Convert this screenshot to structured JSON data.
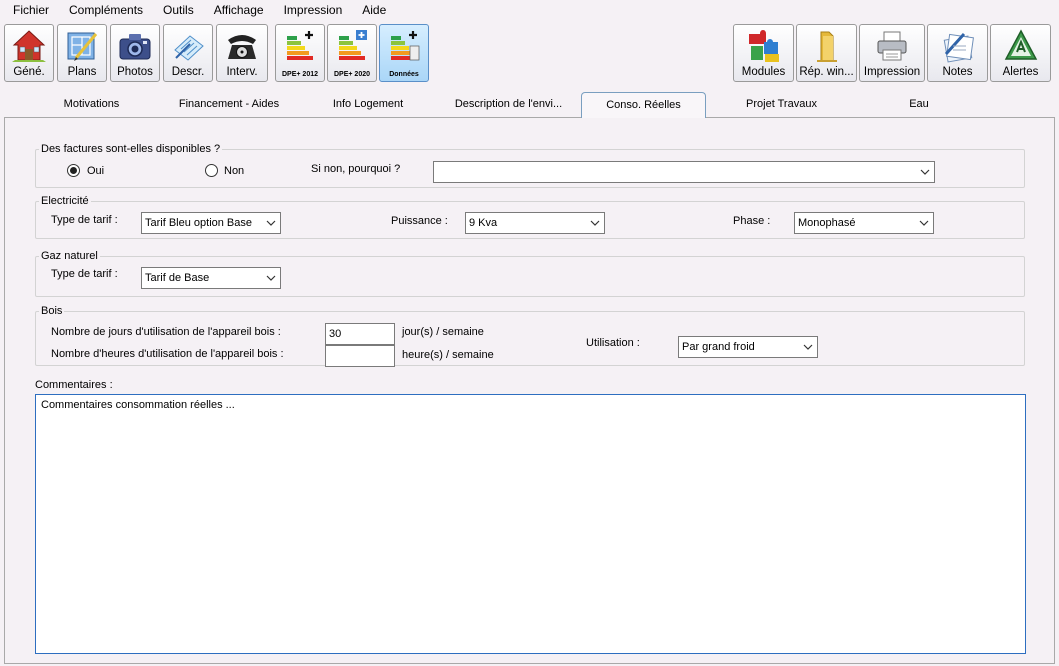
{
  "menu": [
    "Fichier",
    "Compléments",
    "Outils",
    "Affichage",
    "Impression",
    "Aide"
  ],
  "toolbar_left": [
    {
      "label": "Géné.",
      "icon": "house-icon"
    },
    {
      "label": "Plans",
      "icon": "plans-icon"
    },
    {
      "label": "Photos",
      "icon": "camera-icon"
    },
    {
      "label": "Descr.",
      "icon": "description-icon"
    },
    {
      "label": "Interv.",
      "icon": "telephone-icon"
    },
    {
      "label": "DPE+ 2012",
      "icon": "energy-label-icon"
    },
    {
      "label": "DPE+ 2020",
      "icon": "energy-label-icon"
    },
    {
      "label": "Données",
      "icon": "energy-label-icon"
    }
  ],
  "toolbar_right": [
    {
      "label": "Modules",
      "icon": "puzzle-icon"
    },
    {
      "label": "Rép. win...",
      "icon": "folder-icon"
    },
    {
      "label": "Impression",
      "icon": "printer-icon"
    },
    {
      "label": "Notes",
      "icon": "notes-icon"
    },
    {
      "label": "Alertes",
      "icon": "warning-icon"
    }
  ],
  "tabs": [
    "Motivations",
    "Financement  - Aides",
    "Info Logement",
    "Description de l'envi...",
    "Conso. Réelles",
    "Projet Travaux",
    "Eau"
  ],
  "active_tab": "Conso. Réelles",
  "factures": {
    "legend": "Des factures sont-elles disponibles ?",
    "oui": "Oui",
    "non": "Non",
    "selected": "Oui",
    "why_label": "Si non, pourquoi ?",
    "why_value": ""
  },
  "electricite": {
    "legend": "Electricité",
    "tarif_label": "Type de tarif :",
    "tarif_value": "Tarif Bleu option Base",
    "puissance_label": "Puissance :",
    "puissance_value": "9 Kva",
    "phase_label": "Phase :",
    "phase_value": "Monophasé"
  },
  "gaz": {
    "legend": "Gaz naturel",
    "tarif_label": "Type de tarif :",
    "tarif_value": "Tarif de Base"
  },
  "bois": {
    "legend": "Bois",
    "jours_label": "Nombre de jours d'utilisation de l'appareil bois :",
    "jours_value": "30",
    "jours_unit": "jour(s) / semaine",
    "heures_label": "Nombre d'heures d'utilisation de l'appareil bois :",
    "heures_value": "",
    "heures_unit": "heure(s) / semaine",
    "utilisation_label": "Utilisation :",
    "utilisation_value": "Par grand froid"
  },
  "commentaires": {
    "label": "Commentaires :",
    "value": "Commentaires consommation réelles ..."
  },
  "colors": {
    "accent": "#2d6ec0",
    "selected_button": "#aad6f7",
    "background": "#f5f1f5"
  }
}
